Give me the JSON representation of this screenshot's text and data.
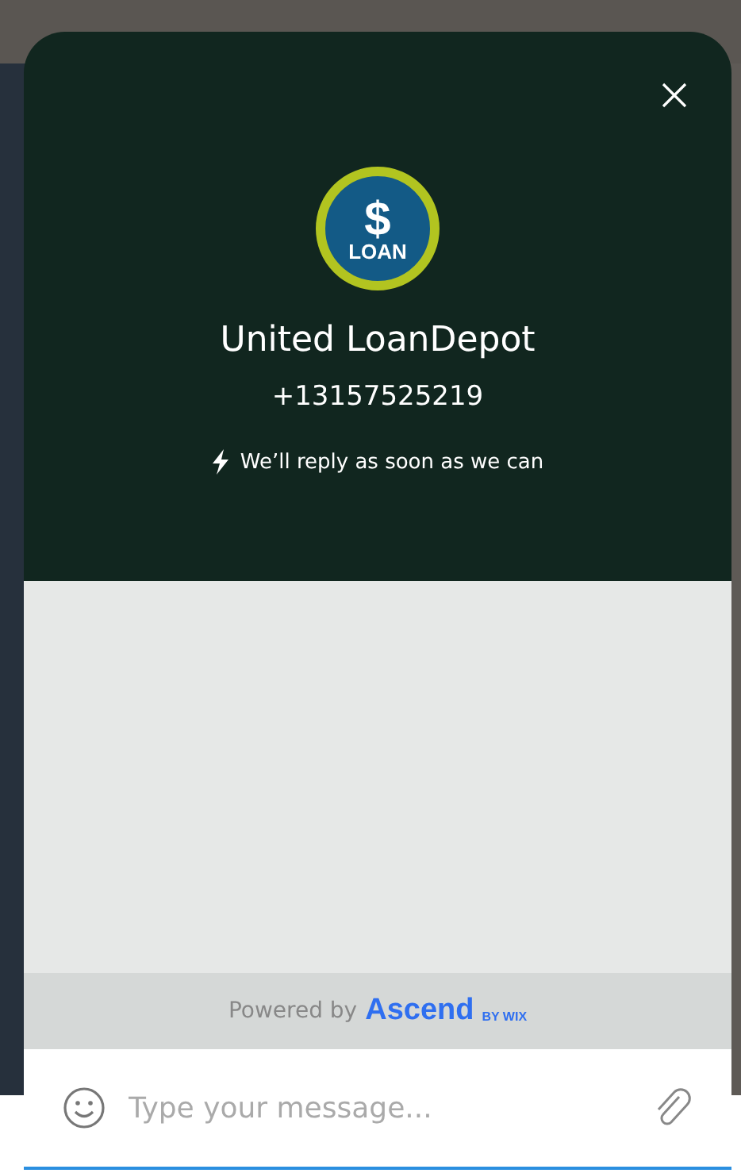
{
  "header": {
    "logo": {
      "symbol": "$",
      "text": "LOAN"
    },
    "business_name": "United LoanDepot",
    "phone": "+13157525219",
    "reply_note": "We’ll reply as soon as we can"
  },
  "branding": {
    "prefix": "Powered by",
    "brand": "Ascend",
    "suffix": "BY WIX"
  },
  "composer": {
    "placeholder": "Type your message..."
  }
}
